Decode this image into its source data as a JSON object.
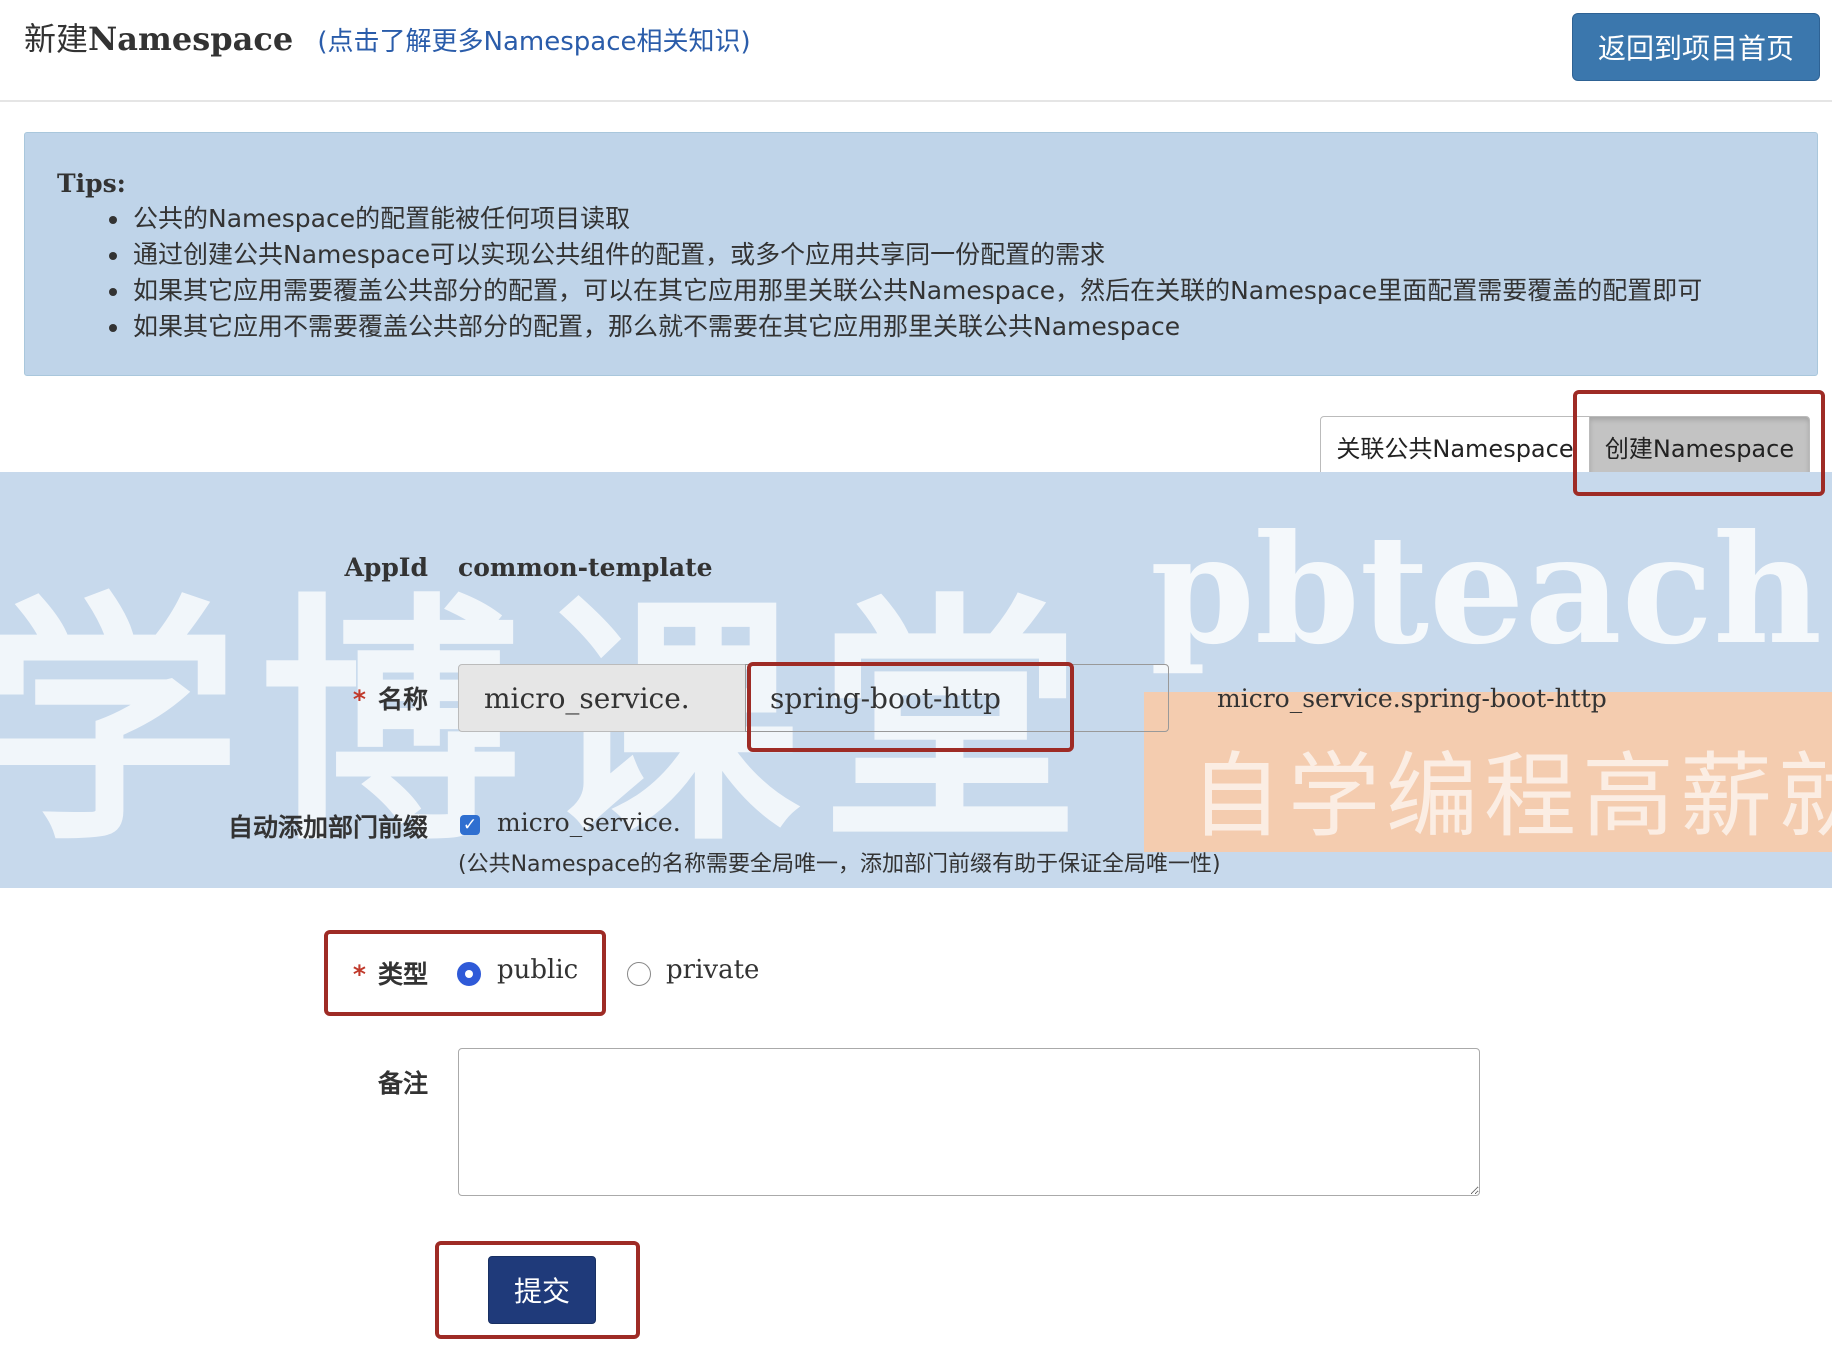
{
  "header": {
    "title_prefix": "新建",
    "title_ns": "Namespace",
    "help_link": "(点击了解更多Namespace相关知识)",
    "back_button": "返回到项目首页"
  },
  "tips": {
    "title": "Tips:",
    "items": [
      "公共的Namespace的配置能被任何项目读取",
      "通过创建公共Namespace可以实现公共组件的配置，或多个应用共享同一份配置的需求",
      "如果其它应用需要覆盖公共部分的配置，可以在其它应用那里关联公共Namespace，然后在关联的Namespace里面配置需要覆盖的配置即可",
      "如果其它应用不需要覆盖公共部分的配置，那么就不需要在其它应用那里关联公共Namespace"
    ]
  },
  "tabs": {
    "link_public": "关联公共Namespace",
    "create": "创建Namespace"
  },
  "watermark": {
    "brand_cn": "学博课堂",
    "site": "pbteach.co",
    "slogan": "自学编程高薪就"
  },
  "form": {
    "appid_label": "AppId",
    "appid_value": "common-template",
    "required_mark": "*",
    "name_label": "名称",
    "name_prefix": "micro_service.",
    "name_value": "spring-boot-http",
    "name_preview": "micro_service.spring-boot-http",
    "auto_prefix_label": "自动添加部门前缀",
    "auto_prefix_checkbox_text": "micro_service.",
    "auto_prefix_checked": true,
    "auto_prefix_hint": "(公共Namespace的名称需要全局唯一，添加部门前缀有助于保证全局唯一性)",
    "type_label": "类型",
    "type_options": [
      "public",
      "private"
    ],
    "type_selected": "public",
    "comment_label": "备注",
    "comment_value": "",
    "submit_button": "提交"
  },
  "colors": {
    "primary_button": "#3b77ad",
    "submit_button": "#1f3a7a",
    "tips_background": "#bfd4e9",
    "highlight_border": "#9e2b25",
    "radio_selected": "#2f5ad8"
  },
  "icons": {
    "checkbox": "check-icon",
    "radio_selected": "radio-checked-icon",
    "radio_unselected": "radio-unchecked-icon"
  }
}
